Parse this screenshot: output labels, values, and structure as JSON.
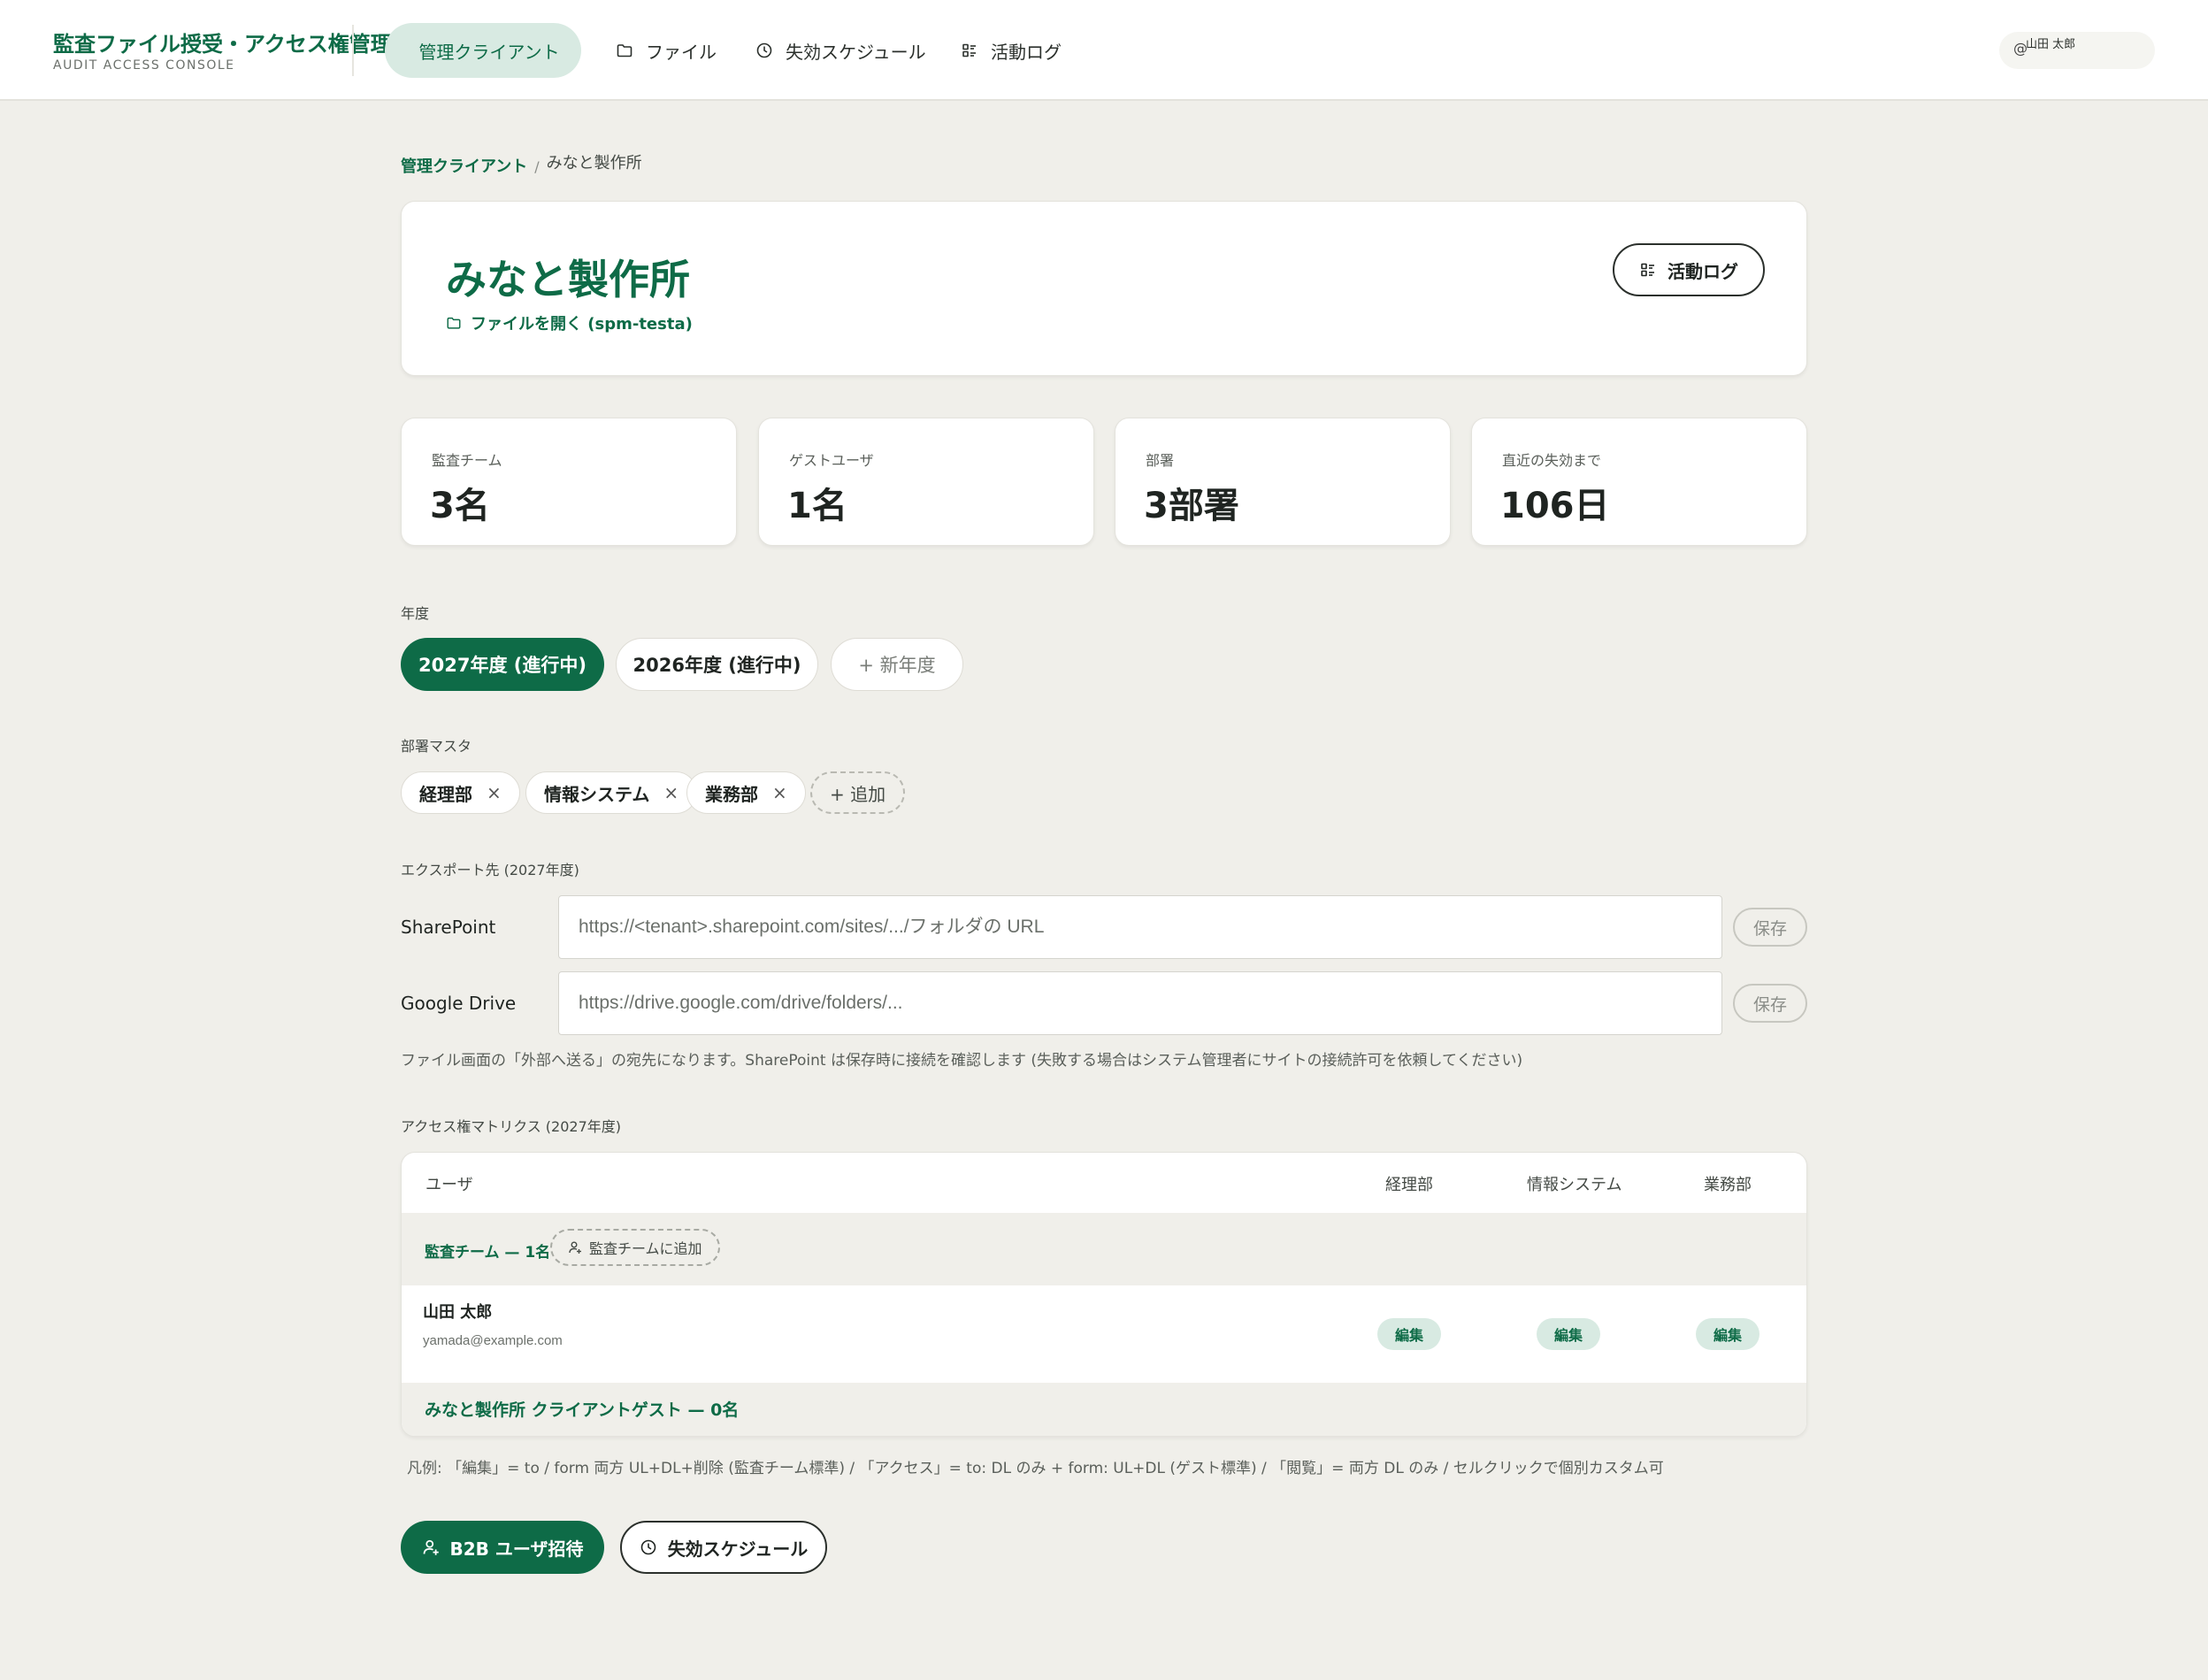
{
  "app": {
    "title": "監査ファイル授受・アクセス権管理",
    "subtitle": "AUDIT ACCESS CONSOLE"
  },
  "nav": {
    "clients": "管理クライアント",
    "files": "ファイル",
    "schedule": "失効スケジュール",
    "activity": "活動ログ"
  },
  "user": {
    "at": "@",
    "name": "山田 太郎"
  },
  "breadcrumb": {
    "parent": "管理クライアント",
    "sep": "/",
    "current": "みなと製作所"
  },
  "client": {
    "name": "みなと製作所",
    "open_files": "ファイルを開く (spm-testa)",
    "activity_button": "活動ログ"
  },
  "stats": [
    {
      "label": "監査チーム",
      "value": "3名"
    },
    {
      "label": "ゲストユーザ",
      "value": "1名"
    },
    {
      "label": "部署",
      "value": "3部署"
    },
    {
      "label": "直近の失効まで",
      "value": "106日"
    }
  ],
  "fiscal_year": {
    "label": "年度",
    "items": [
      "2027年度 (進行中)",
      "2026年度 (進行中)"
    ],
    "new_label": "+ 新年度"
  },
  "departments": {
    "label": "部署マスタ",
    "items": [
      "経理部",
      "情報システム",
      "業務部"
    ],
    "remove_glyph": "×",
    "add_label": "+ 追加"
  },
  "export": {
    "label": "エクスポート先 (2027年度)",
    "sharepoint_label": "SharePoint",
    "sharepoint_placeholder": "https://<tenant>.sharepoint.com/sites/.../フォルダの URL",
    "gdrive_label": "Google Drive",
    "gdrive_placeholder": "https://drive.google.com/drive/folders/...",
    "save_label": "保存",
    "hint": "ファイル画面の「外部へ送る」の宛先になります。SharePoint は保存時に接続を確認します (失敗する場合はシステム管理者にサイトの接続許可を依頼してください)"
  },
  "matrix": {
    "label": "アクセス権マトリクス (2027年度)",
    "columns": {
      "user": "ユーザ",
      "dept1": "経理部",
      "dept2": "情報システム",
      "dept3": "業務部"
    },
    "team_group": "監査チーム — 1名",
    "add_team_label": "監査チームに追加",
    "row": {
      "name": "山田 太郎",
      "email": "yamada@example.com",
      "perm1": "編集",
      "perm2": "編集",
      "perm3": "編集"
    },
    "guest_group": "みなと製作所 クライアントゲスト — 0名",
    "legend": "凡例: 「編集」= to / form 両方 UL+DL+削除 (監査チーム標準) / 「アクセス」= to: DL のみ + form: UL+DL (ゲスト標準) / 「閲覧」= 両方 DL のみ / セルクリックで個別カスタム可"
  },
  "actions": {
    "invite": "B2B ユーザ招待",
    "schedule": "失効スケジュール"
  },
  "colors": {
    "accent": "#0e6b47",
    "accent_soft": "#d8eae2",
    "background": "#f0efea"
  }
}
